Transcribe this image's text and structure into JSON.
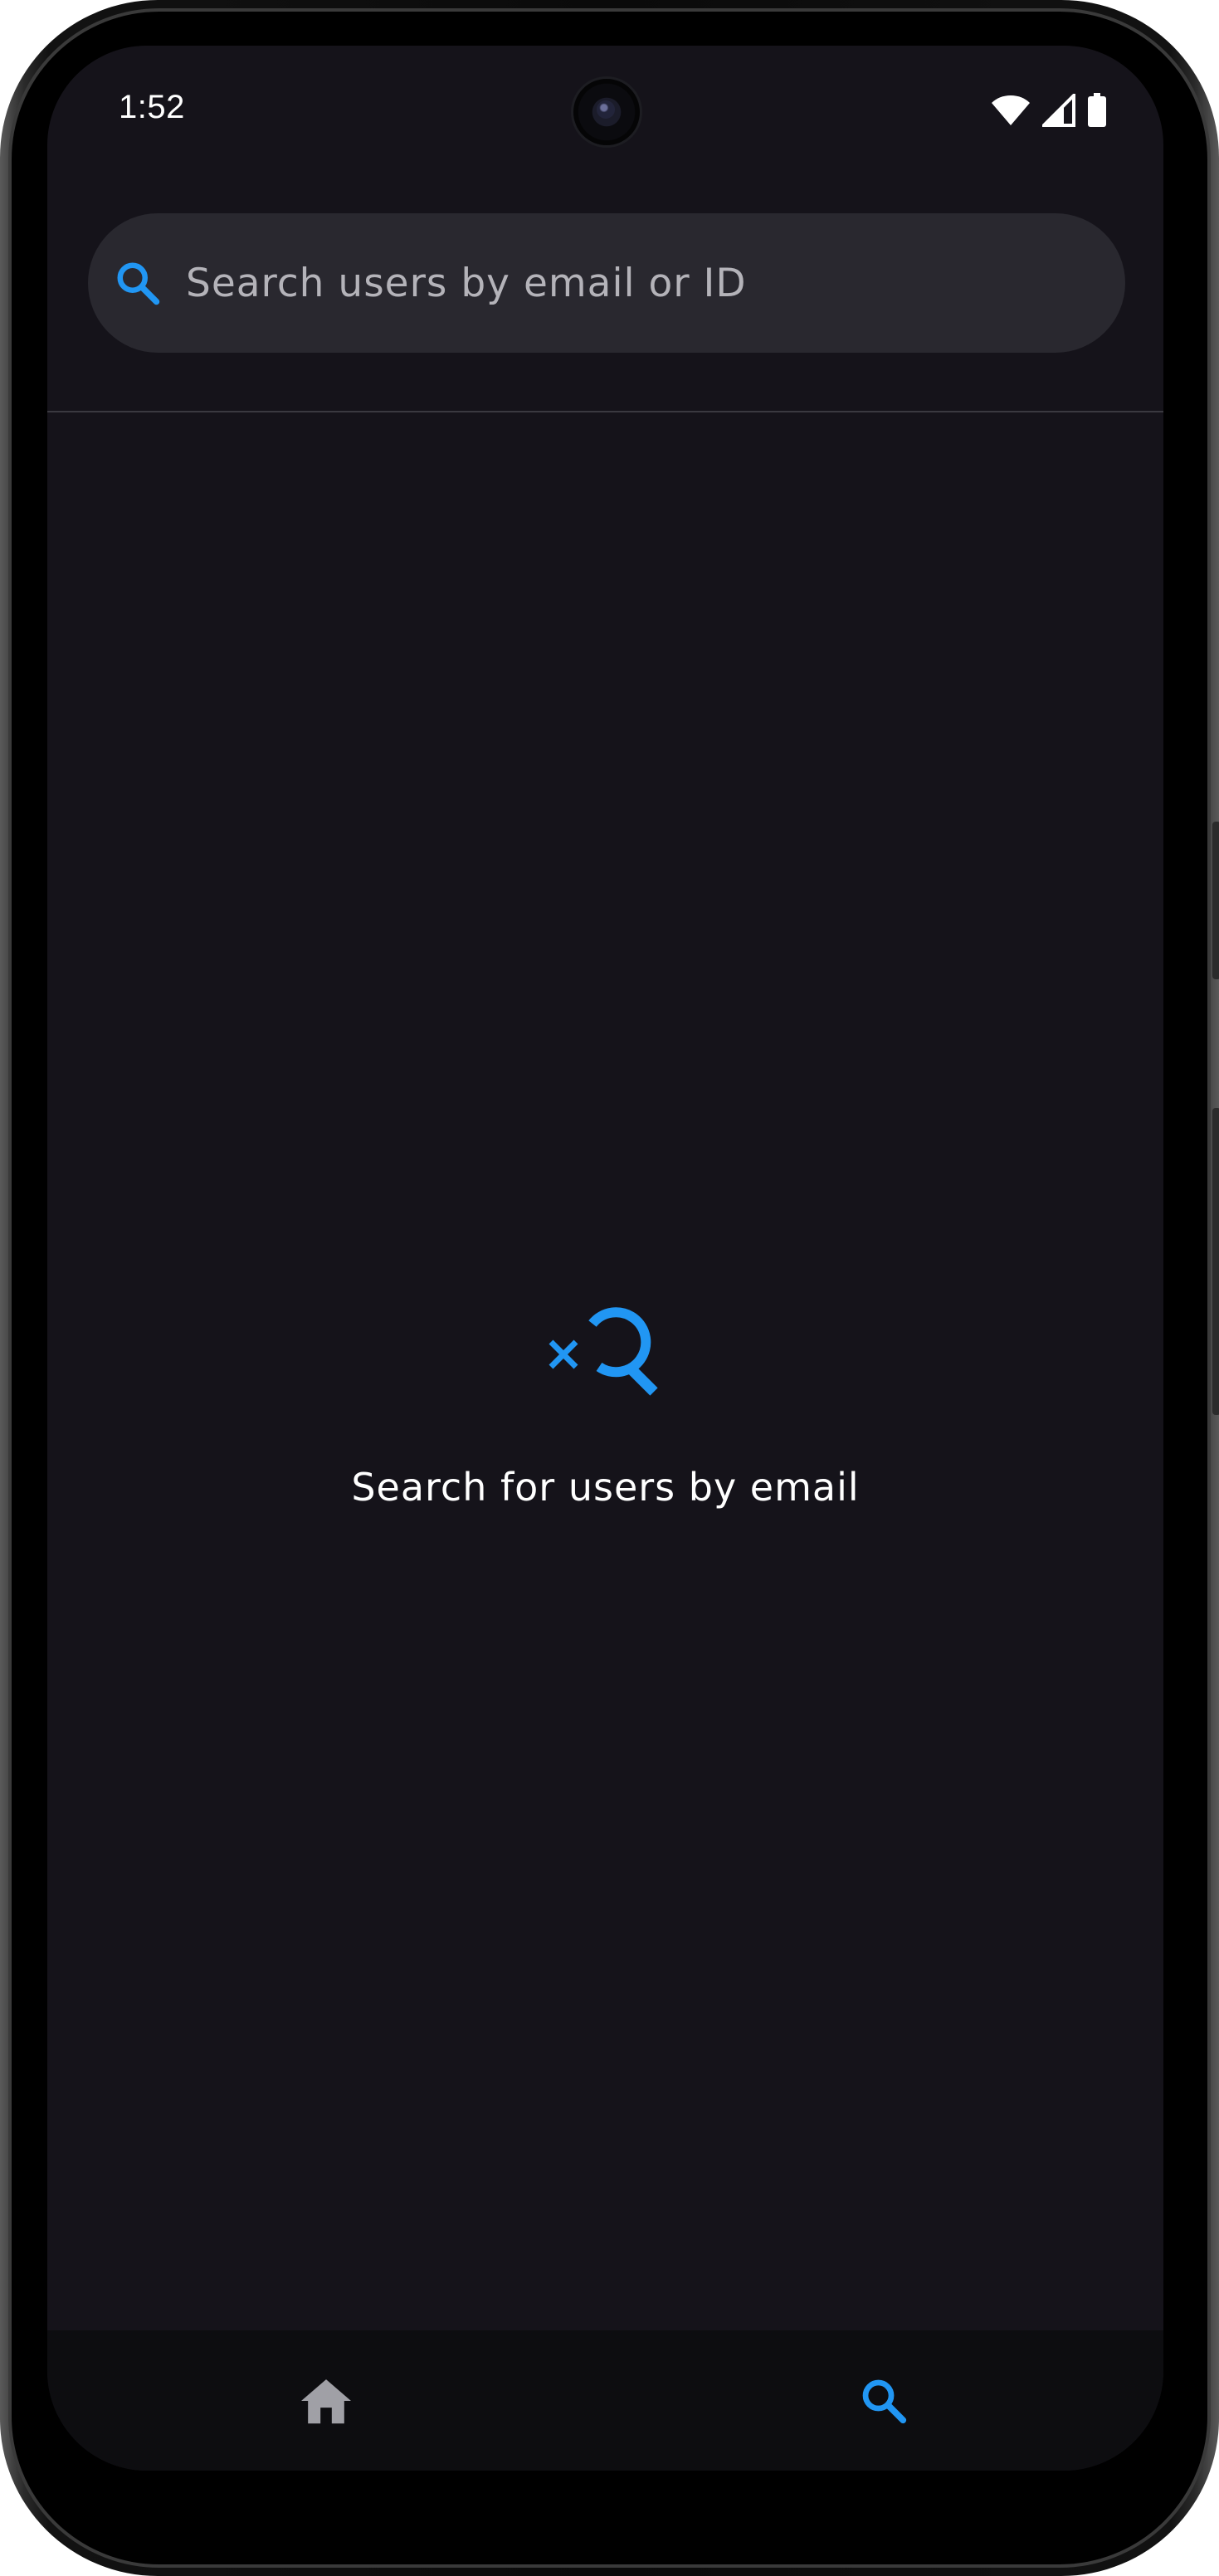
{
  "status_bar": {
    "time": "1:52",
    "icons": [
      "wifi-icon",
      "cell-signal-icon",
      "battery-icon"
    ]
  },
  "search": {
    "placeholder": "Search users by email or ID",
    "value": "",
    "icon": "search-icon"
  },
  "empty_state": {
    "icon": "search-off-icon",
    "message": "Search for users by email"
  },
  "bottom_nav": {
    "items": [
      {
        "icon": "home-icon",
        "active": false
      },
      {
        "icon": "search-icon",
        "active": true
      }
    ]
  },
  "colors": {
    "background": "#15131a",
    "search_field": "#29282f",
    "accent": "#2196f3",
    "inactive_icon": "#a0a0a6",
    "nav_background": "#0d0d10",
    "text": "#ffffff",
    "placeholder": "#b4b3b9"
  }
}
